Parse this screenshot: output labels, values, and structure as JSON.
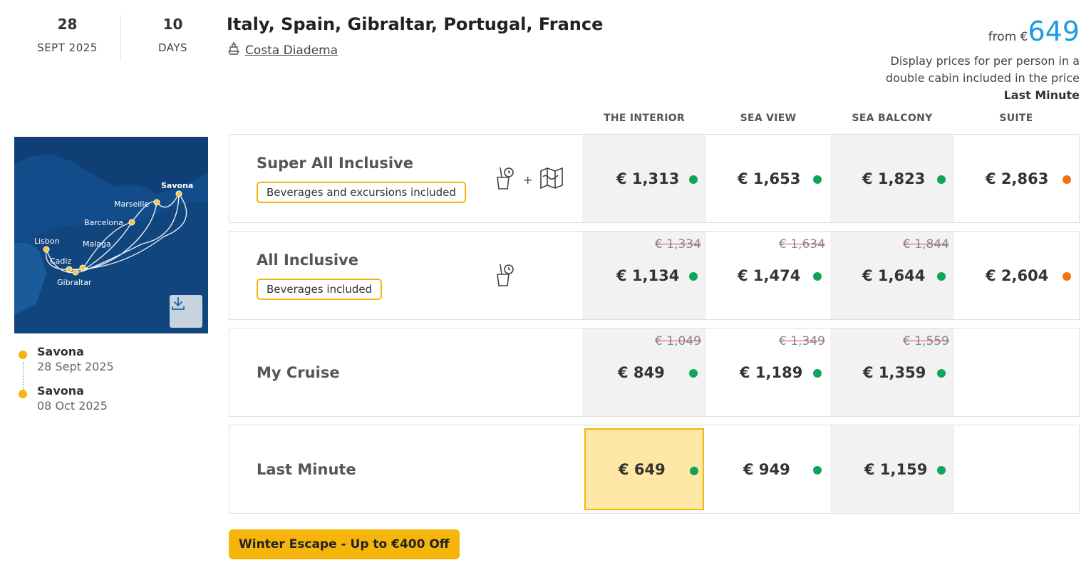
{
  "header": {
    "day": "28",
    "month_year": "SEPT 2025",
    "days_num": "10",
    "days_label": "DAYS",
    "title": "Italy, Spain, Gibraltar, Portugal, France",
    "ship": "Costa Diadema",
    "from_label": "from €",
    "from_amount": "649",
    "note_line1": "Display prices for per person in a",
    "note_line2": "double cabin included in the price",
    "note_fare": "Last Minute"
  },
  "map": {
    "ports": [
      "Savona",
      "Marseille",
      "Barcelona",
      "Lisbon",
      "Malaga",
      "Cadiz",
      "Gibraltar"
    ]
  },
  "itinerary": [
    {
      "port": "Savona",
      "date": "28 Sept 2025"
    },
    {
      "port": "Savona",
      "date": "08 Oct 2025"
    }
  ],
  "cabins": [
    "THE INTERIOR",
    "SEA VIEW",
    "SEA BALCONY",
    "SUITE"
  ],
  "fares": [
    {
      "name": "Super All Inclusive",
      "badge": "Beverages and excursions included",
      "prices": [
        {
          "old": "",
          "price": "€ 1,313",
          "status": "#10a35a"
        },
        {
          "old": "",
          "price": "€ 1,653",
          "status": "#10a35a"
        },
        {
          "old": "",
          "price": "€ 1,823",
          "status": "#10a35a"
        },
        {
          "old": "",
          "price": "€ 2,863",
          "status": "#f07214"
        }
      ]
    },
    {
      "name": "All Inclusive",
      "badge": "Beverages included",
      "prices": [
        {
          "old": "€ 1,334",
          "price": "€ 1,134",
          "status": "#10a35a"
        },
        {
          "old": "€ 1,634",
          "price": "€ 1,474",
          "status": "#10a35a"
        },
        {
          "old": "€ 1,844",
          "price": "€ 1,644",
          "status": "#10a35a"
        },
        {
          "old": "",
          "price": "€ 2,604",
          "status": "#f07214"
        }
      ]
    },
    {
      "name": "My Cruise",
      "badge": "",
      "prices": [
        {
          "old": "€ 1,049",
          "price": "€ 849",
          "status": "#10a35a"
        },
        {
          "old": "€ 1,349",
          "price": "€ 1,189",
          "status": "#10a35a"
        },
        {
          "old": "€ 1,559",
          "price": "€ 1,359",
          "status": "#10a35a"
        }
      ]
    },
    {
      "name": "Last Minute",
      "badge": "",
      "prices": [
        {
          "old": "",
          "price": "€ 649",
          "status": "#10a35a"
        },
        {
          "old": "",
          "price": "€ 949",
          "status": "#10a35a"
        },
        {
          "old": "",
          "price": "€ 1,159",
          "status": "#10a35a"
        }
      ]
    }
  ],
  "promo": "Winter Escape - Up to €400 Off",
  "colors": {
    "accent": "#f6b50a",
    "price_blue": "#1e9be6",
    "available": "#10a35a",
    "limited": "#f07214"
  }
}
